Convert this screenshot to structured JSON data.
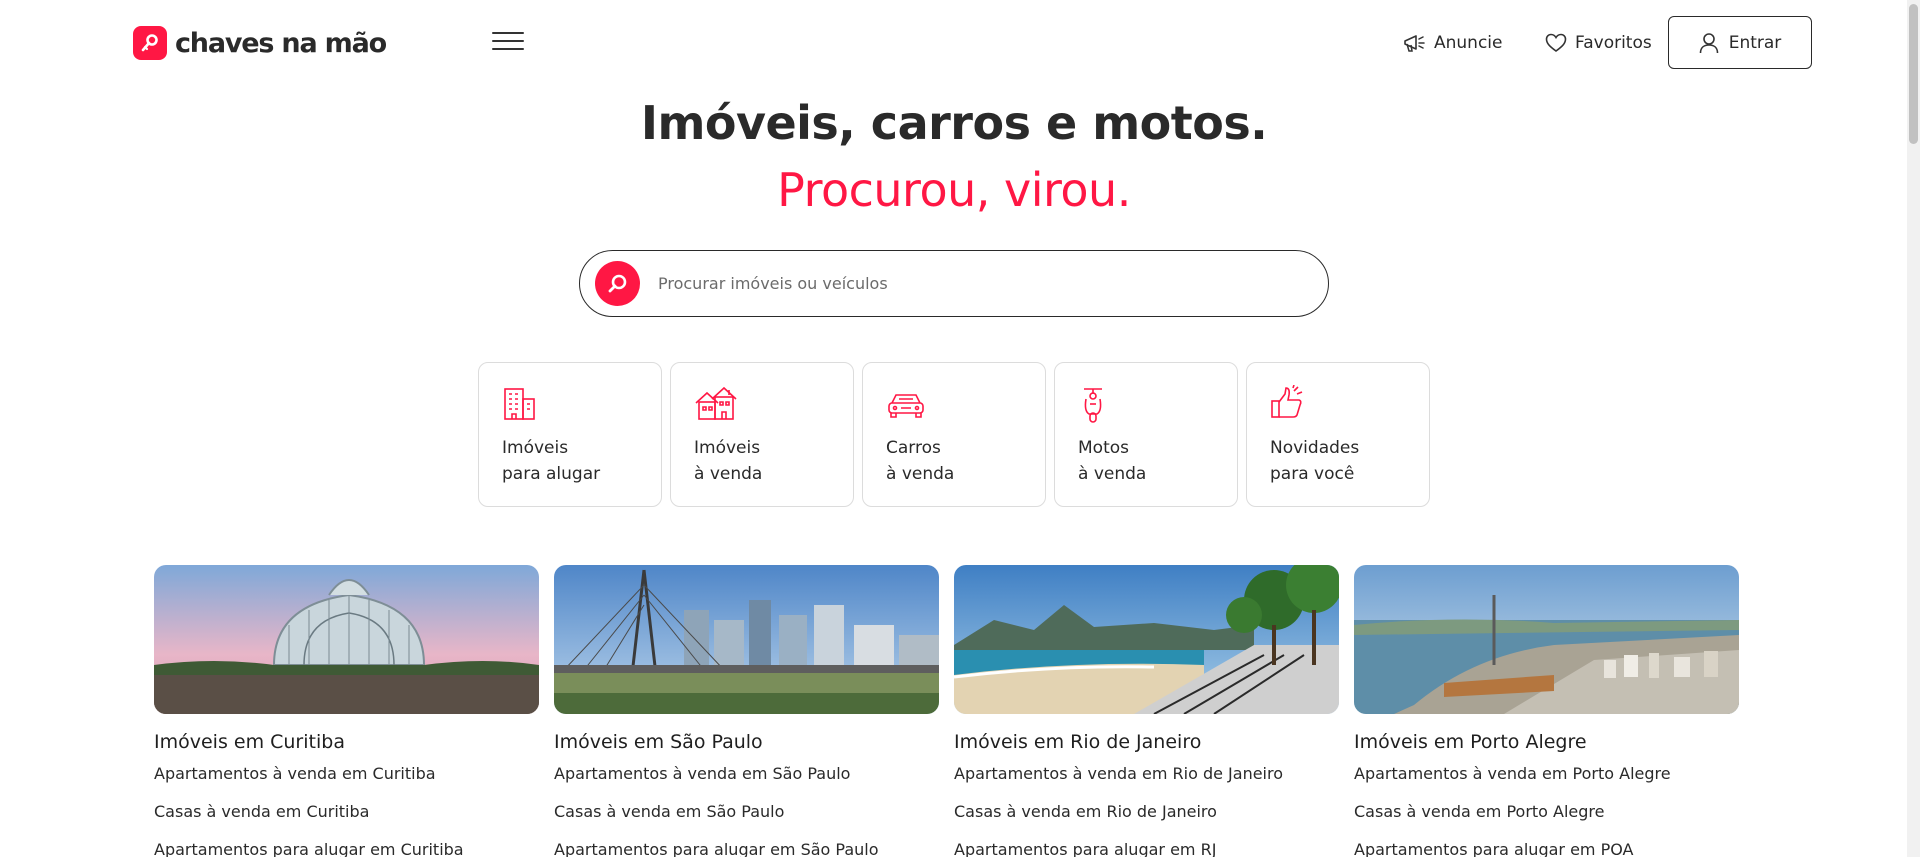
{
  "brand": {
    "name": "chaves na mão",
    "accent": "#ff1744"
  },
  "header": {
    "menu_icon": "hamburger-menu-icon",
    "anuncie": "Anuncie",
    "favoritos": "Favoritos",
    "entrar": "Entrar"
  },
  "hero": {
    "title": "Imóveis, carros e motos.",
    "subtitle": "Procurou, virou."
  },
  "search": {
    "placeholder": "Procurar imóveis ou veículos",
    "icon": "search-icon"
  },
  "categories": [
    {
      "icon": "building-icon",
      "line1": "Imóveis",
      "line2": "para alugar"
    },
    {
      "icon": "house-icon",
      "line1": "Imóveis",
      "line2": "à venda"
    },
    {
      "icon": "car-icon",
      "line1": "Carros",
      "line2": "à venda"
    },
    {
      "icon": "scooter-icon",
      "line1": "Motos",
      "line2": "à venda"
    },
    {
      "icon": "thumbs-up-icon",
      "line1": "Novidades",
      "line2": "para você"
    }
  ],
  "cities": [
    {
      "title": "Imóveis em Curitiba",
      "links": [
        "Apartamentos à venda em Curitiba",
        "Casas à venda em Curitiba",
        "Apartamentos para alugar em Curitiba"
      ]
    },
    {
      "title": "Imóveis em São Paulo",
      "links": [
        "Apartamentos à venda em São Paulo",
        "Casas à venda em São Paulo",
        "Apartamentos para alugar em São Paulo"
      ]
    },
    {
      "title": "Imóveis em Rio de Janeiro",
      "links": [
        "Apartamentos à venda em Rio de Janeiro",
        "Casas à venda em Rio de Janeiro",
        "Apartamentos para alugar em RJ"
      ]
    },
    {
      "title": "Imóveis em Porto Alegre",
      "links": [
        "Apartamentos à venda em Porto Alegre",
        "Casas à venda em Porto Alegre",
        "Apartamentos para alugar em POA"
      ]
    }
  ]
}
